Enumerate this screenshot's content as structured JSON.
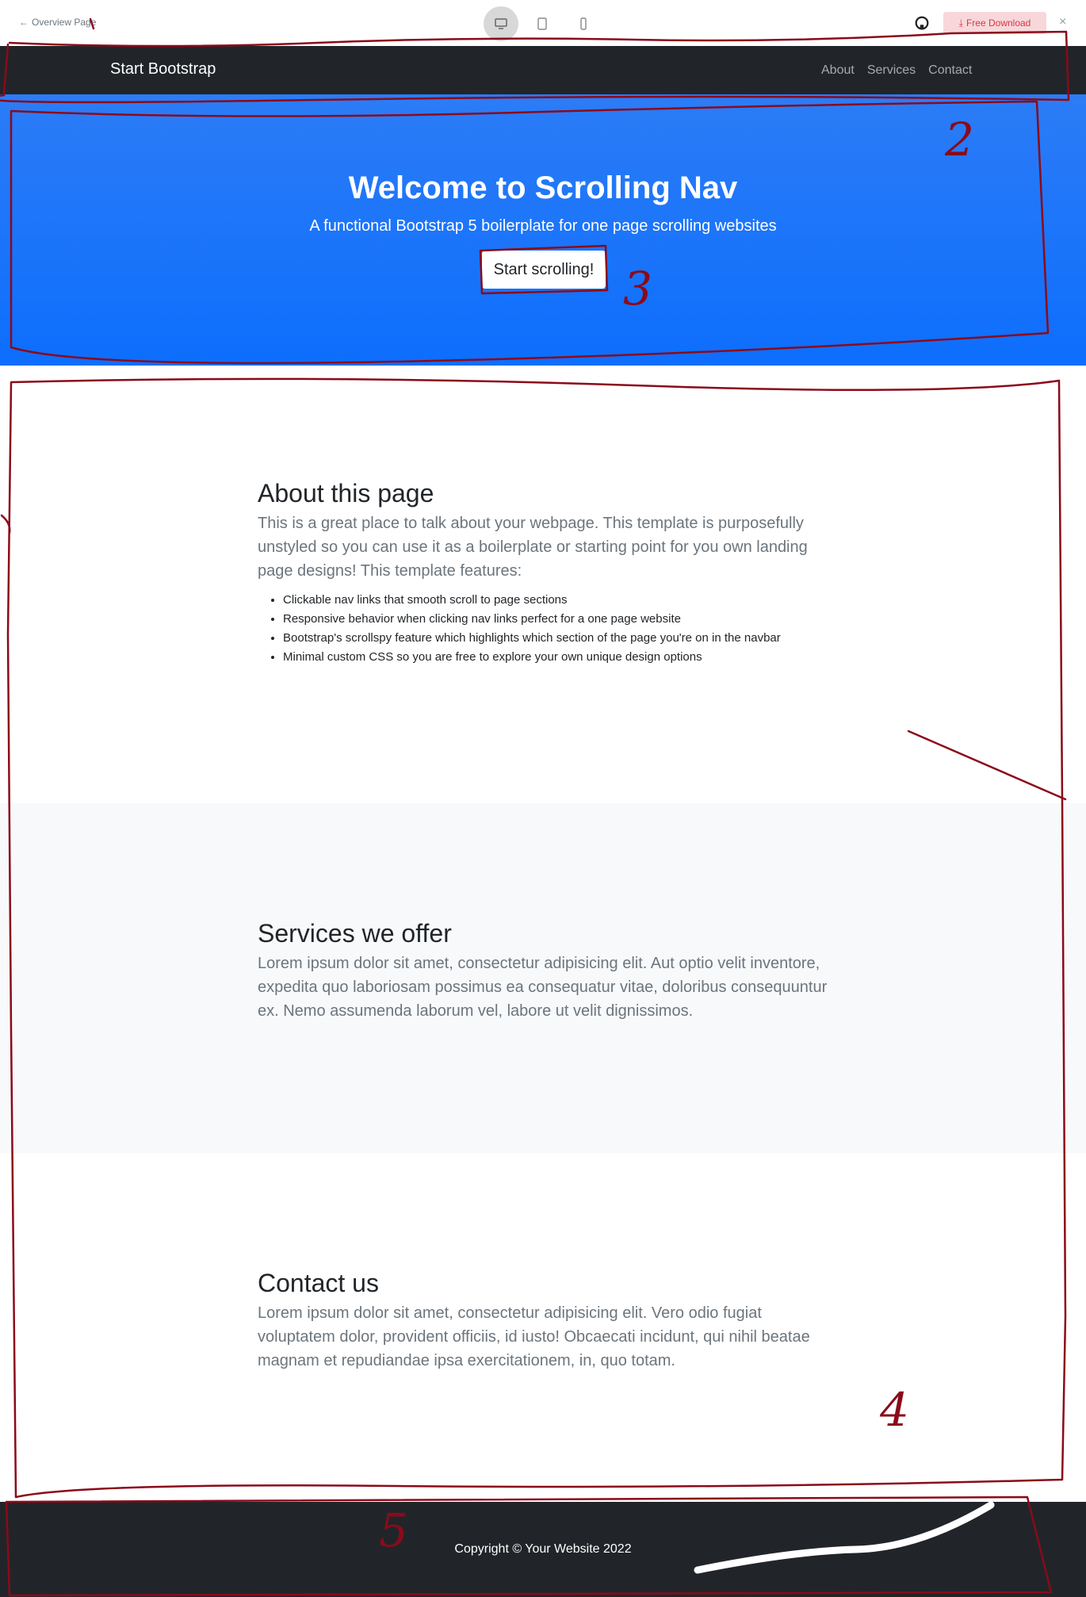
{
  "preview_bar": {
    "back_label": "Overview Page",
    "download_label": "Free Download",
    "close_label": "×",
    "devices": [
      "desktop-icon",
      "tablet-icon",
      "phone-icon"
    ]
  },
  "navbar": {
    "brand": "Start Bootstrap",
    "links": [
      "About",
      "Services",
      "Contact"
    ]
  },
  "hero": {
    "title": "Welcome to Scrolling Nav",
    "subtitle": "A functional Bootstrap 5 boilerplate for one page scrolling websites",
    "button_label": "Start scrolling!"
  },
  "about": {
    "heading": "About this page",
    "lead": "This is a great place to talk about your webpage. This template is purposefully unstyled so you can use it as a boilerplate or starting point for you own landing page designs! This template features:",
    "features": [
      "Clickable nav links that smooth scroll to page sections",
      "Responsive behavior when clicking nav links perfect for a one page website",
      "Bootstrap's scrollspy feature which highlights which section of the page you're on in the navbar",
      "Minimal custom CSS so you are free to explore your own unique design options"
    ]
  },
  "services": {
    "heading": "Services we offer",
    "lead": "Lorem ipsum dolor sit amet, consectetur adipisicing elit. Aut optio velit inventore, expedita quo laboriosam possimus ea consequatur vitae, doloribus consequuntur ex. Nemo assumenda laborum vel, labore ut velit dignissimos."
  },
  "contact": {
    "heading": "Contact us",
    "lead": "Lorem ipsum dolor sit amet, consectetur adipisicing elit. Vero odio fugiat voluptatem dolor, provident officiis, id iusto! Obcaecati incidunt, qui nihil beatae magnam et repudiandae ipsa exercitationem, in, quo totam."
  },
  "footer": {
    "copyright": "Copyright © Your Website 2022"
  },
  "annotations": {
    "labels": [
      "2",
      "3",
      "4",
      "5"
    ],
    "ink_color": "#8b0a1a",
    "scribble_color": "#ffffff"
  }
}
